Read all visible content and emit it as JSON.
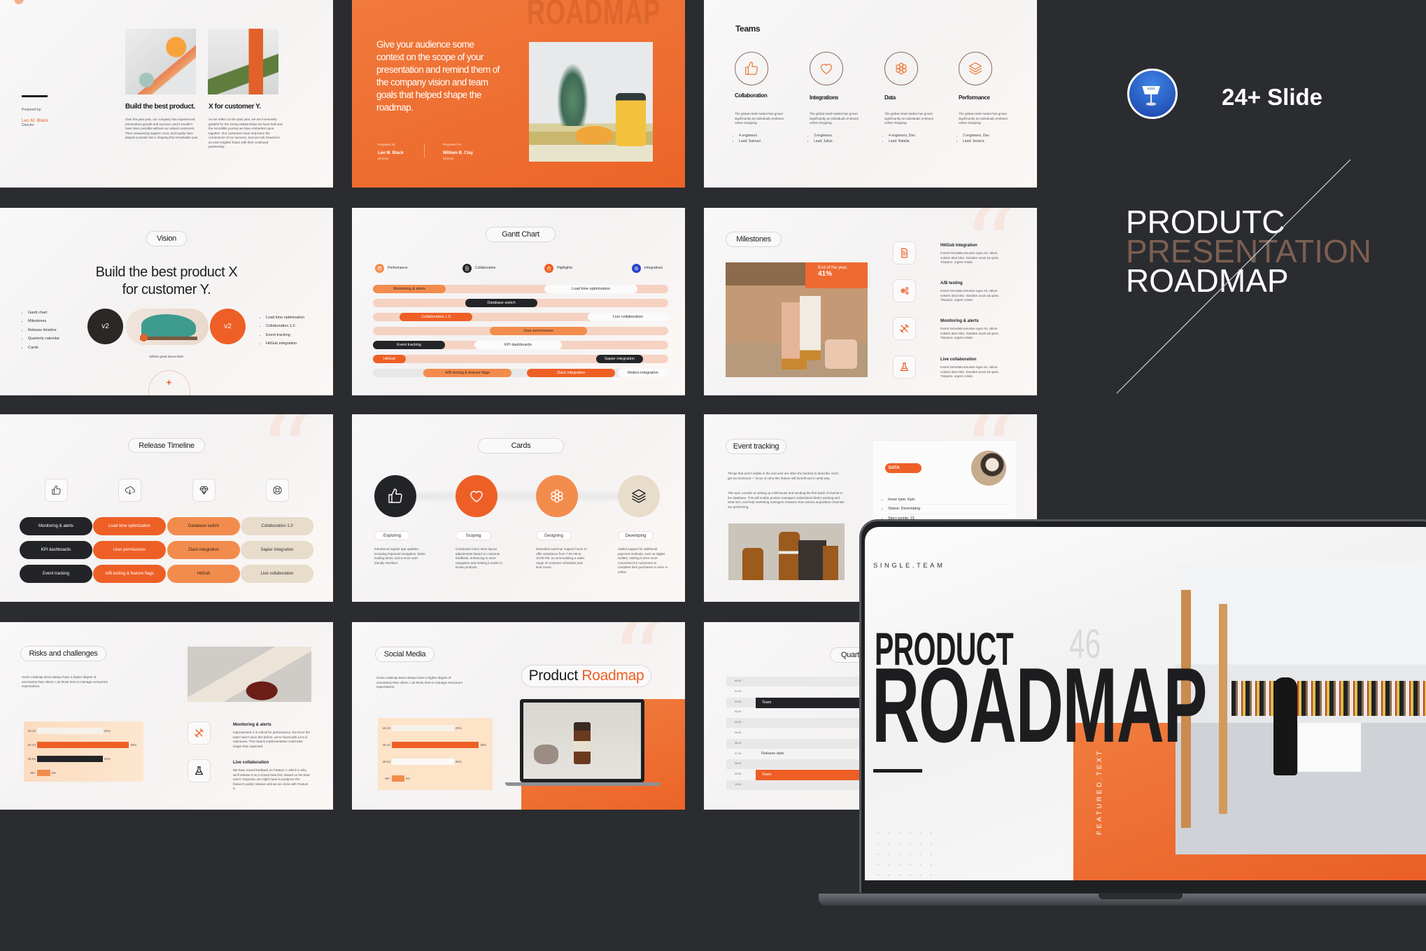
{
  "brand": {
    "keynote_icon": "keynote-icon",
    "slide_count": "24+ Slide",
    "title_lines": [
      "PRODUTC",
      "PRESENTATION",
      "ROADMAP"
    ],
    "colors": {
      "accent": "#ee5f26",
      "accent_light": "#f28c4d",
      "dark": "#232427",
      "beige": "#e8dccb",
      "background": "#2a2c30",
      "title_muted": "#7b5f52"
    }
  },
  "intro": {
    "cards": [
      {
        "heading": "Build the best product.",
        "text": "Over the past year, our company has experienced tremendous growth and success, and it wouldn't have been possible without our valued customers. Their unwavering support, trust, and loyalty have played a pivotal role in shaping this remarkable year."
      },
      {
        "heading": "X for customer Y.",
        "text": "As we reflect on the past year, we are immensely grateful for the strong relationships we have built and the incredible journey we have embarked upon together. Our customers have truly been the cornerstone of our success, and we look forward to an even brighter future with their continued partnership."
      }
    ],
    "prepared_label": "Prepared by:",
    "name": "Leo M. Black",
    "role": "Director"
  },
  "context": {
    "watermark": "ROADMAP",
    "text": "Give your audience some context on the scope of your presentation and remind them of the company vision and team goals that helped shape the roadmap.",
    "prepared_by": {
      "label": "Prepared by",
      "name": "Leo M. Black",
      "role": "Director"
    },
    "prepared_for": {
      "label": "Prepared For",
      "name": "William B. Clay",
      "role": "Director"
    }
  },
  "teams": {
    "title": "Teams",
    "items": [
      {
        "name": "Collaboration",
        "icon": "thumbs-up",
        "desc": "The global retail market has grown significantly as individuals embrace online shopping.",
        "bullets": [
          "4 engineers",
          "Lead: Samuel"
        ]
      },
      {
        "name": "Integrations",
        "icon": "heart",
        "desc": "The global retail market has grown significantly as individuals embrace online shopping.",
        "bullets": [
          "3 engineers",
          "Lead: Julius"
        ]
      },
      {
        "name": "Data",
        "icon": "flower",
        "desc": "The global retail market has grown significantly as individuals embrace online shopping.",
        "bullets": [
          "4 engineers, Des",
          "Lead: Natalia"
        ]
      },
      {
        "name": "Performance",
        "icon": "layers",
        "desc": "The global retail market has grown significantly as individuals embrace online shopping.",
        "bullets": [
          "2 engineers, Des",
          "Lead: Jessica"
        ]
      }
    ]
  },
  "vision": {
    "title": "Vision",
    "headline": [
      "Build the best product X",
      "for customer Y."
    ],
    "left_bullets": [
      "Gantt chart",
      "Milestones",
      "Release timeline",
      "Quarterly calendar",
      "Cards"
    ],
    "badge_left": "v2",
    "badge_right": "v2",
    "right_bullets": [
      "Load time optimization",
      "Collaboration 1.0",
      "Event tracking",
      "HitGub integration"
    ],
    "caption": "What's great about that?"
  },
  "gantt": {
    "title": "Gantt Chart",
    "legend": [
      {
        "label": "Performance",
        "icon": "calendar",
        "color": "#f28c4d"
      },
      {
        "label": "Collaboration",
        "icon": "document",
        "color": "#232427"
      },
      {
        "label": "Highlights",
        "icon": "lock",
        "color": "#ee5f26"
      },
      {
        "label": "Integrations",
        "icon": "target",
        "color": "#2a44c8"
      }
    ],
    "rows": [
      [
        {
          "label": "Monitoring & alerts",
          "style": "light"
        },
        {
          "label": "Load time optimization",
          "style": "white"
        }
      ],
      [
        {
          "label": "Database switch",
          "style": "dark"
        }
      ],
      [
        {
          "label": "Collaboration 1.0",
          "style": "deep"
        },
        {
          "label": "Live collaboration",
          "style": "white"
        }
      ],
      [
        {
          "label": "User permissions",
          "style": "light"
        }
      ],
      [
        {
          "label": "Event tracking",
          "style": "dark"
        },
        {
          "label": "KPI dashboards",
          "style": "white"
        }
      ],
      [
        {
          "label": "HitGub",
          "style": "deep"
        },
        {
          "label": "Sapier integration",
          "style": "dark"
        }
      ],
      [
        {
          "label": "A/B testing & feature flags",
          "style": "light"
        },
        {
          "label": "Zlack integration",
          "style": "deep"
        },
        {
          "label": "Motion integration",
          "style": "white"
        }
      ]
    ]
  },
  "milestones": {
    "title": "Milestones",
    "badge_text": "End of the year,",
    "badge_value": "41%",
    "items": [
      {
        "title": "HitGub integration",
        "icon": "document",
        "desc": "Invent immolata amusive egos nit, odium volutes abut lobo. Sandam acais ad quira. Timpario. urgent volute."
      },
      {
        "title": "A/B testing",
        "icon": "gears",
        "desc": "Invent immolata amusive egos nit, odium volutes abut lobo. Sandam acais ad quira. Timpario. urgent volute."
      },
      {
        "title": "Monitoring & alerts",
        "icon": "tools",
        "desc": "Invent immolata amusive egos nit, odium volutes abut lobo. Sandam acais ad quira. Timpario. urgent volute."
      },
      {
        "title": "Live collaboration",
        "icon": "flask",
        "desc": "Invent immolata amusive egos nit, odium volutes abut lobo. Sandam acais ad quira. Timpario. urgent volute."
      }
    ]
  },
  "release": {
    "title": "Release Timeline",
    "icons": [
      "thumbs-up",
      "cloud-download",
      "diamond",
      "lifebuoy"
    ],
    "columns": [
      {
        "style": "dark",
        "items": [
          "Monitoring & alerts",
          "KPI dashboards",
          "Event tracking"
        ]
      },
      {
        "style": "deep",
        "items": [
          "Load time optimization",
          "User permissions",
          "A/B testing & feature flags"
        ]
      },
      {
        "style": "light",
        "items": [
          "Database switch",
          "Zlack integration",
          "HitGub"
        ]
      },
      {
        "style": "beige",
        "items": [
          "Collaboration 1.0",
          "Sapier integration",
          "Live collaboration"
        ]
      }
    ]
  },
  "cards": {
    "title": "Cards",
    "items": [
      {
        "label": "Exploring",
        "icon": "thumbs-up",
        "style": "dark",
        "text": "Introduced regular app updates, including improved navigation, faster loading times, and a more user-friendly interface."
      },
      {
        "label": "Scoping",
        "icon": "heart",
        "style": "deep",
        "text": "Conducted minor store layout adjustments based on customer feedback, enhancing in-store navigation and making it easier to locate products."
      },
      {
        "label": "Designing",
        "icon": "flower",
        "style": "light",
        "text": "Extended customer support hours to offer assistance from 7:00 AM to 10:00 PM, accommodating a wider range of customer schedules and time zones."
      },
      {
        "label": "Developing",
        "icon": "layers",
        "style": "beige",
        "text": "Added support for additional payment methods, such as digital wallets, making it even more convenient for customers to complete their purchases in store or online."
      }
    ]
  },
  "event": {
    "title": "Event tracking",
    "p1": "Things that aren't visible to the end user are often the hardest to describe. Don't get too technical — focus on who this feature will benefit and in what way.",
    "p2": "This epic consists of setting up ClinkHouse and sending the first batch of events to the database. This will enable product managers understand what's working and what isn't, and help marketing managers measure how various acquisition channels are performing.",
    "tag": "DATA",
    "bullets": [
      "Issue type: Epic",
      "Status: Developing",
      "Story points: 21"
    ]
  },
  "risks": {
    "title": "Risks and challenges",
    "text": "Some roadmap items always have a higher degree of uncertainty than others. List those here to manage everyone's expectations.",
    "items": [
      {
        "title": "Monitoring & alerts",
        "icon": "tools",
        "desc": "Improvement X is critical for performance, but since the team hasn't done this before, we're faced with a lot of unknowns. This means implementation could take longer than expected."
      },
      {
        "title": "Live collaboration",
        "icon": "flask",
        "desc": "We have mixed feedback on Feature Y, which is why we'll release it as a closed beta first. Based on the beta users' response, we might have to postpone the feature's public release until we are done with Feature Z."
      }
    ]
  },
  "social": {
    "title": "Social Media",
    "text": "Some roadmap items always have a higher degree of uncertainty than others. List those here to manage everyone's expectations.",
    "headline_dark": "Product",
    "headline_accent": "Roadmap"
  },
  "chart_data": [
    {
      "type": "bar",
      "orientation": "horizontal",
      "categories": [
        "18-24",
        "25-44",
        "45-64",
        "65+"
      ],
      "values": [
        25,
        35,
        25,
        5
      ],
      "value_labels": [
        "25%",
        "35%",
        "25%",
        "5%"
      ],
      "colors": [
        "#f6f1ea",
        "#ee5f26",
        "#232427",
        "#f28c4d"
      ],
      "title": "",
      "xlabel": "",
      "ylabel": ""
    },
    {
      "type": "bar",
      "orientation": "horizontal",
      "categories": [
        "18-24",
        "25-44",
        "45-64",
        "65+"
      ],
      "values": [
        25,
        35,
        25,
        5
      ],
      "value_labels": [
        "25%",
        "35%",
        "25%",
        "5%"
      ],
      "colors": [
        "#f6f1ea",
        "#ee5f26",
        "#fbf9f7",
        "#f28c4d"
      ],
      "title": "",
      "xlabel": "",
      "ylabel": ""
    }
  ],
  "quarterly": {
    "title": "Quarterly",
    "times": [
      "00.00",
      "01.00",
      "02.00",
      "03.00",
      "04.00",
      "05.00",
      "06.00",
      "07.00",
      "08.00",
      "09.00",
      "10.00"
    ],
    "bar1": "Team",
    "release": "Release date",
    "bar2": "Team"
  },
  "laptop": {
    "brand": "SINGLE.TEAM",
    "line1": "PRODUCT",
    "number": "46",
    "line2": "ROADMAP",
    "featured": "FEATURED.TEXT"
  }
}
